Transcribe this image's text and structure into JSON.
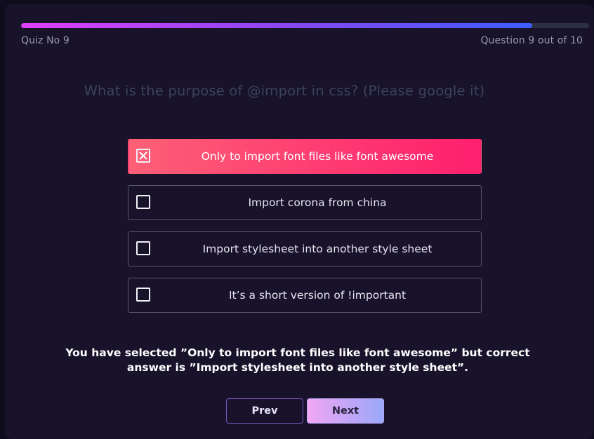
{
  "header": {
    "quiz_label": "Quiz No 9",
    "question_counter": "Question 9 out of 10",
    "progress_fraction": 0.9
  },
  "question": {
    "text": "What is the purpose of @import in css? (Please google it)"
  },
  "options": [
    {
      "label": "Only to import font files like font awesome",
      "selected": true
    },
    {
      "label": "Import corona from china",
      "selected": false
    },
    {
      "label": "Import stylesheet into another style sheet",
      "selected": false
    },
    {
      "label": "It’s a short version of !important",
      "selected": false
    }
  ],
  "result": {
    "line1": "You have selected ”Only to import font files like font awesome” but correct",
    "line2": "answer is ”Import stylesheet into another style sheet”."
  },
  "navigation": {
    "prev_label": "Prev",
    "next_label": "Next"
  },
  "colors": {
    "background": "#18122b",
    "selected_option_gradient_start": "#fc6076",
    "selected_option_gradient_end": "#ff1f6e",
    "progress_gradient_start": "#e040fb",
    "progress_gradient_end": "#3d5cff"
  }
}
